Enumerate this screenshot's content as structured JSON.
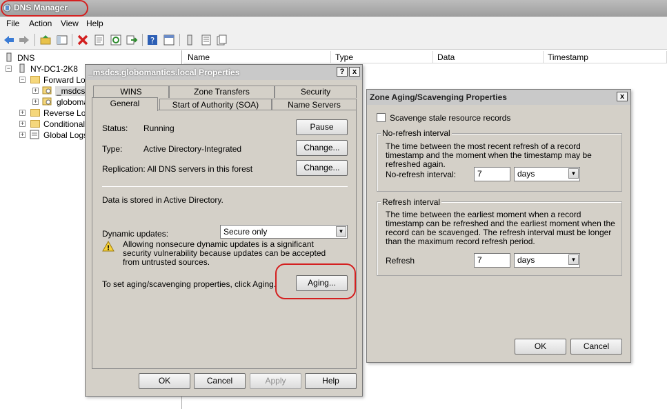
{
  "window": {
    "title": "DNS Manager"
  },
  "menu": [
    "File",
    "Action",
    "View",
    "Help"
  ],
  "toolbar_icons": [
    "back-arrow-icon",
    "forward-arrow-icon",
    "up-folder-icon",
    "show-hide-tree-icon",
    "delete-icon",
    "properties-icon",
    "refresh-icon",
    "export-icon",
    "help-icon",
    "console-icon",
    "list-icon",
    "zone-icon"
  ],
  "tree": {
    "root": "DNS",
    "server": "NY-DC1-2K8",
    "forward": "Forward Loo",
    "msdcs": "_msdcs.g",
    "globo": "globoma",
    "reverse": "Reverse Loo",
    "conditional": "Conditional F",
    "globallogs": "Global Logs"
  },
  "list_columns": [
    "Name",
    "Type",
    "Data",
    "Timestamp"
  ],
  "props": {
    "title": "_msdcs.globomantics.local Properties",
    "help_btn": "?",
    "close_btn": "x",
    "tabs_back": [
      "WINS",
      "Zone Transfers",
      "Security"
    ],
    "tabs_front": [
      "General",
      "Start of Authority (SOA)",
      "Name Servers"
    ],
    "status_label": "Status:",
    "status_value": "Running",
    "pause_btn": "Pause",
    "type_label": "Type:",
    "type_value": "Active Directory-Integrated",
    "change_btn": "Change...",
    "replication_text": "Replication:  All DNS servers in this forest",
    "change_btn2": "Change...",
    "stored_text": "Data is stored in Active Directory.",
    "dyn_label": "Dynamic updates:",
    "dyn_value": "Secure only",
    "warning_text": "Allowing nonsecure dynamic updates is a significant security vulnerability because updates can be accepted from untrusted sources.",
    "aging_text": "To set aging/scavenging properties, click Aging.",
    "aging_btn": "Aging...",
    "ok": "OK",
    "cancel": "Cancel",
    "apply": "Apply",
    "help": "Help"
  },
  "aging": {
    "title": "Zone Aging/Scavenging Properties",
    "close_btn": "x",
    "scavenge_label": "Scavenge stale resource records",
    "scavenge_checked": false,
    "norefresh_group": "No-refresh interval",
    "norefresh_desc": "The time between the most recent refresh of a record timestamp and the moment when the timestamp may be refreshed again.",
    "norefresh_label": "No-refresh interval:",
    "norefresh_value": "7",
    "norefresh_unit": "days",
    "refresh_group": "Refresh interval",
    "refresh_desc": "The time between the earliest moment when a record timestamp can be refreshed and the earliest moment when the record can be scavenged. The refresh interval must be longer than the maximum record refresh period.",
    "refresh_label": "Refresh",
    "refresh_value": "7",
    "refresh_unit": "days",
    "ok": "OK",
    "cancel": "Cancel"
  }
}
